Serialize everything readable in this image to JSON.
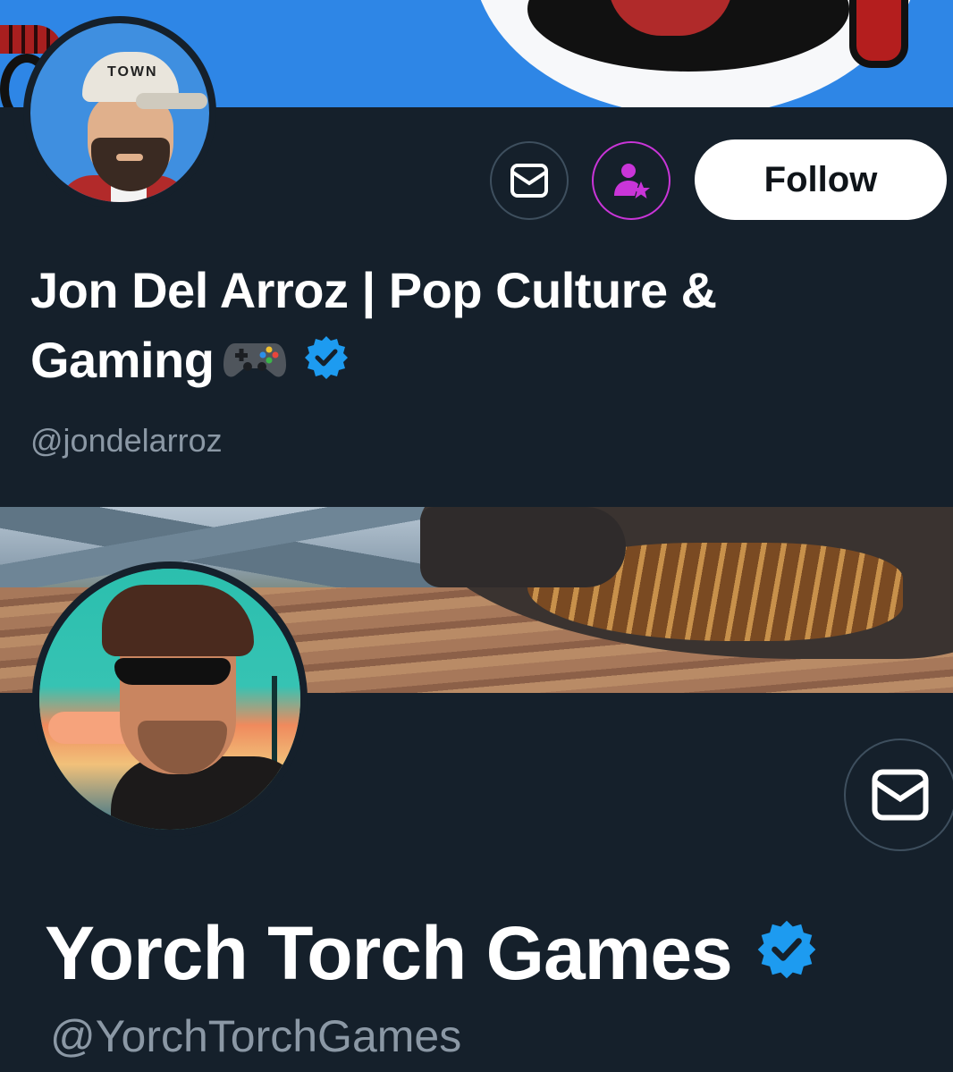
{
  "profiles": [
    {
      "display_name": "Jon Del Arroz | Pop Culture &",
      "display_name_line2": "Gaming",
      "name_emoji": "game-controller-emoji",
      "verified": true,
      "handle": "@jondelarroz",
      "avatar_cap_text": "TOWN",
      "buttons": {
        "message_icon": "envelope-icon",
        "subscribe_icon": "person-star-icon",
        "follow_label": "Follow"
      }
    },
    {
      "display_name": "Yorch Torch Games",
      "verified": true,
      "handle": "@YorchTorchGames",
      "buttons": {
        "message_icon": "envelope-icon"
      }
    }
  ],
  "colors": {
    "background": "#15202b",
    "text_primary": "#ffffff",
    "text_secondary": "#8b98a5",
    "verified_blue": "#1d9bf0",
    "subscribe_accent": "#c935d8",
    "follow_bg": "#ffffff",
    "follow_text": "#0f1419"
  }
}
